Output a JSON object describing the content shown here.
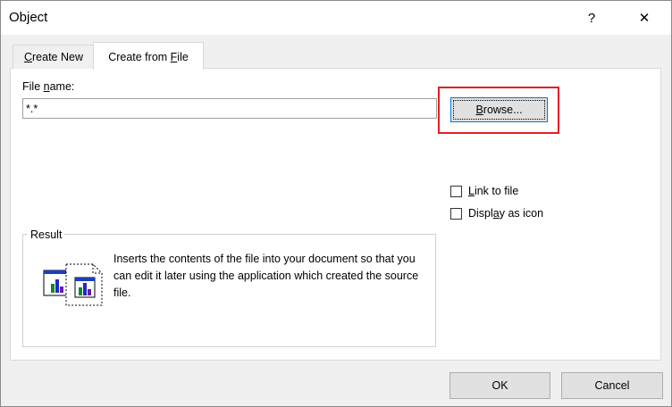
{
  "window": {
    "title": "Object",
    "help_glyph": "?",
    "close_glyph": "✕"
  },
  "tabs": [
    {
      "label_prefix": "",
      "label_accel": "C",
      "label_rest": "reate New"
    },
    {
      "label_prefix": "Create from ",
      "label_accel": "F",
      "label_rest": "ile"
    }
  ],
  "file": {
    "label_prefix": "File ",
    "label_accel": "n",
    "label_rest": "ame:",
    "value": "*.*"
  },
  "browse": {
    "accel": "B",
    "rest": "rowse..."
  },
  "options": {
    "link": {
      "accel": "L",
      "rest": "ink to file"
    },
    "display": {
      "prefix": "Displ",
      "accel": "a",
      "rest": "y as icon"
    }
  },
  "result": {
    "legend": "Result",
    "text": "Inserts the contents of the file into your document so that you can edit it later using the application which created the source file.",
    "icon": "insert-object-icon"
  },
  "buttons": {
    "ok": "OK",
    "cancel": "Cancel"
  },
  "colors": {
    "highlight": "#e21f26",
    "focus": "#0078d7"
  }
}
